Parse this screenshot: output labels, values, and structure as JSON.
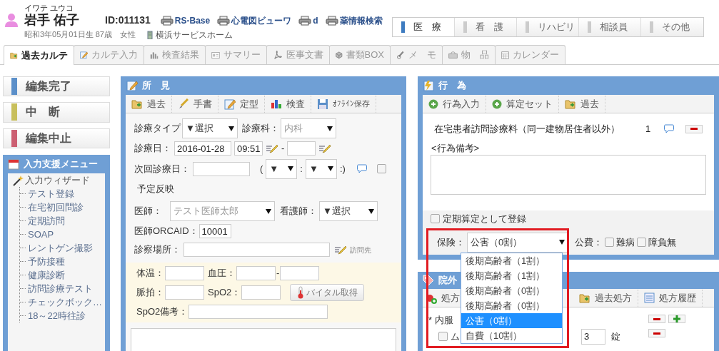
{
  "patient": {
    "kana": "イワテ ユウコ",
    "name": "岩手 佑子",
    "id": "ID:011131",
    "links": [
      "RS-Base",
      "心電図ビューワ",
      "d",
      "薬情報検索"
    ],
    "birth": "昭和3年05月01日生 87歳　女性",
    "facility": "横浜サービスホーム"
  },
  "dept_tabs": [
    {
      "label": "医　療",
      "selected": true
    },
    {
      "label": "看　護",
      "selected": false
    },
    {
      "label": "リハビリ",
      "selected": false
    },
    {
      "label": "相談員",
      "selected": false
    },
    {
      "label": "その他",
      "selected": false
    }
  ],
  "tabs": [
    {
      "label": "過去カルテ",
      "selected": true
    },
    {
      "label": "カルテ入力",
      "selected": false
    },
    {
      "label": "検査結果",
      "selected": false
    },
    {
      "label": "サマリー",
      "selected": false
    },
    {
      "label": "医事文書",
      "selected": false
    },
    {
      "label": "書類BOX",
      "selected": false
    },
    {
      "label": "メ　モ",
      "selected": false
    },
    {
      "label": "物　品",
      "selected": false
    },
    {
      "label": "カレンダー",
      "selected": false
    }
  ],
  "actions": [
    {
      "label": "編集完了",
      "color": "#5b8fc9"
    },
    {
      "label": "中　断",
      "color": "#c8bf5c"
    },
    {
      "label": "編集中止",
      "color": "#cc5f72"
    }
  ],
  "support_menu": {
    "title": "入力支援メニュー",
    "items": [
      {
        "label": "入力ウィザード",
        "children": [
          {
            "label": "テスト登録"
          },
          {
            "label": "在宅初回問診"
          },
          {
            "label": "定期訪問"
          },
          {
            "label": "SOAP"
          },
          {
            "label": "レントゲン撮影"
          },
          {
            "label": "予防接種"
          },
          {
            "label": "健康診断"
          },
          {
            "label": "訪問診療テスト"
          },
          {
            "label": "チェックボック…"
          },
          {
            "label": "18～22時往診"
          }
        ]
      }
    ]
  },
  "findings": {
    "title": "所　見",
    "toolbar": [
      "過去",
      "手書",
      "定型",
      "検査",
      "ｵﾌﾗｲﾝ保存"
    ],
    "visit_type": {
      "label": "診療タイプ",
      "value": "▼選択"
    },
    "department": {
      "label": "診療科：",
      "value": "内科"
    },
    "visit_date": {
      "label": "診療日：",
      "date": "2016-01-28",
      "time": "09:51",
      "separator": "-"
    },
    "next_visit": {
      "label": "次回診療日：",
      "open": "(",
      "hour": "▼",
      "colon": ":",
      "minute": "▼",
      "close": ":)",
      "reflect": {
        "label": "予定反映",
        "checked": false
      }
    },
    "doctor": {
      "label": "医師：",
      "value": "テスト医師太郎"
    },
    "nurse": {
      "label": "看護師：",
      "value": "▼選択"
    },
    "orca_id": {
      "label": "医師ORCAID：",
      "value": "10001"
    },
    "place": {
      "label": "診察場所：",
      "link": "訪問先"
    },
    "vitals": {
      "temp": "体温：",
      "bp": "血圧：",
      "bp_sep": "-",
      "pulse": "脈拍：",
      "spo2": "SpO2：",
      "button": "バイタル取得",
      "spo2_note": "SpO2備考："
    }
  },
  "acts": {
    "title": "行　為",
    "toolbar": [
      "行為入力",
      "算定セット",
      "過去"
    ],
    "item": {
      "name": "在宅患者訪問診療料（同一建物居住者以外）",
      "qty": "1"
    },
    "note_label": "<行為備考>",
    "periodic": {
      "label": "定期算定として登録",
      "checked": false
    },
    "insurance": {
      "label": "保険：",
      "value": "公害（0割）"
    },
    "public": {
      "label": "公費：",
      "options": [
        {
          "label": "難病",
          "checked": false
        },
        {
          "label": "障負無",
          "checked": false
        }
      ]
    },
    "insurance_options": [
      {
        "label": "後期高齢者（1割）",
        "selected": false
      },
      {
        "label": "後期高齢者（1割）",
        "selected": false
      },
      {
        "label": "後期高齢者（0割）",
        "selected": false
      },
      {
        "label": "後期高齢者（0割）",
        "selected": false
      },
      {
        "label": "公害（0割）",
        "selected": true
      },
      {
        "label": "自費（10割）",
        "selected": false
      }
    ]
  },
  "prescription": {
    "title": "院外",
    "toolbar": [
      "処方",
      "過去処方",
      "処方履歴"
    ],
    "group": "* 内服",
    "drug": {
      "name": "ム",
      "checked": false,
      "amount": "3",
      "unit": "錠"
    }
  }
}
